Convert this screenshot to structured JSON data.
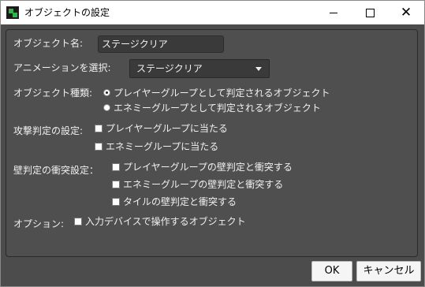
{
  "window": {
    "title": "オブジェクトの設定"
  },
  "form": {
    "object_name_label": "オブジェクト名:",
    "object_name_value": "ステージクリア",
    "animation_label": "アニメーションを選択:",
    "animation_value": "ステージクリア",
    "object_type_label": "オブジェクト種類:",
    "object_type_options": [
      {
        "label": "プレイヤーグループとして判定されるオブジェクト",
        "selected": true
      },
      {
        "label": "エネミーグループとして判定されるオブジェクト",
        "selected": false
      }
    ],
    "attack_label": "攻撃判定の設定:",
    "attack_options": [
      {
        "label": "プレイヤーグループに当たる",
        "checked": false
      },
      {
        "label": "エネミーグループに当たる",
        "checked": false
      }
    ],
    "wall_label": "壁判定の衝突設定：",
    "wall_options": [
      {
        "label": "プレイヤーグループの壁判定と衝突する",
        "checked": false
      },
      {
        "label": "エネミーグループの壁判定と衝突する",
        "checked": false
      },
      {
        "label": "タイルの壁判定と衝突する",
        "checked": false
      }
    ],
    "option_label": "オプション:",
    "option_checkbox_label": "入力デバイスで操作するオブジェクト",
    "option_checked": false
  },
  "buttons": {
    "ok": "OK",
    "cancel": "キャンセル"
  },
  "icons": {
    "app": "app-icon",
    "minimize": "minimize-icon",
    "maximize": "maximize-icon",
    "close": "close-icon",
    "dropdown": "chevron-down-icon"
  },
  "colors": {
    "dialog_background": "#4c4c4c",
    "panel_background": "#4f4f4f",
    "field_background": "#3a3a3a",
    "text": "#f0f0f0"
  }
}
